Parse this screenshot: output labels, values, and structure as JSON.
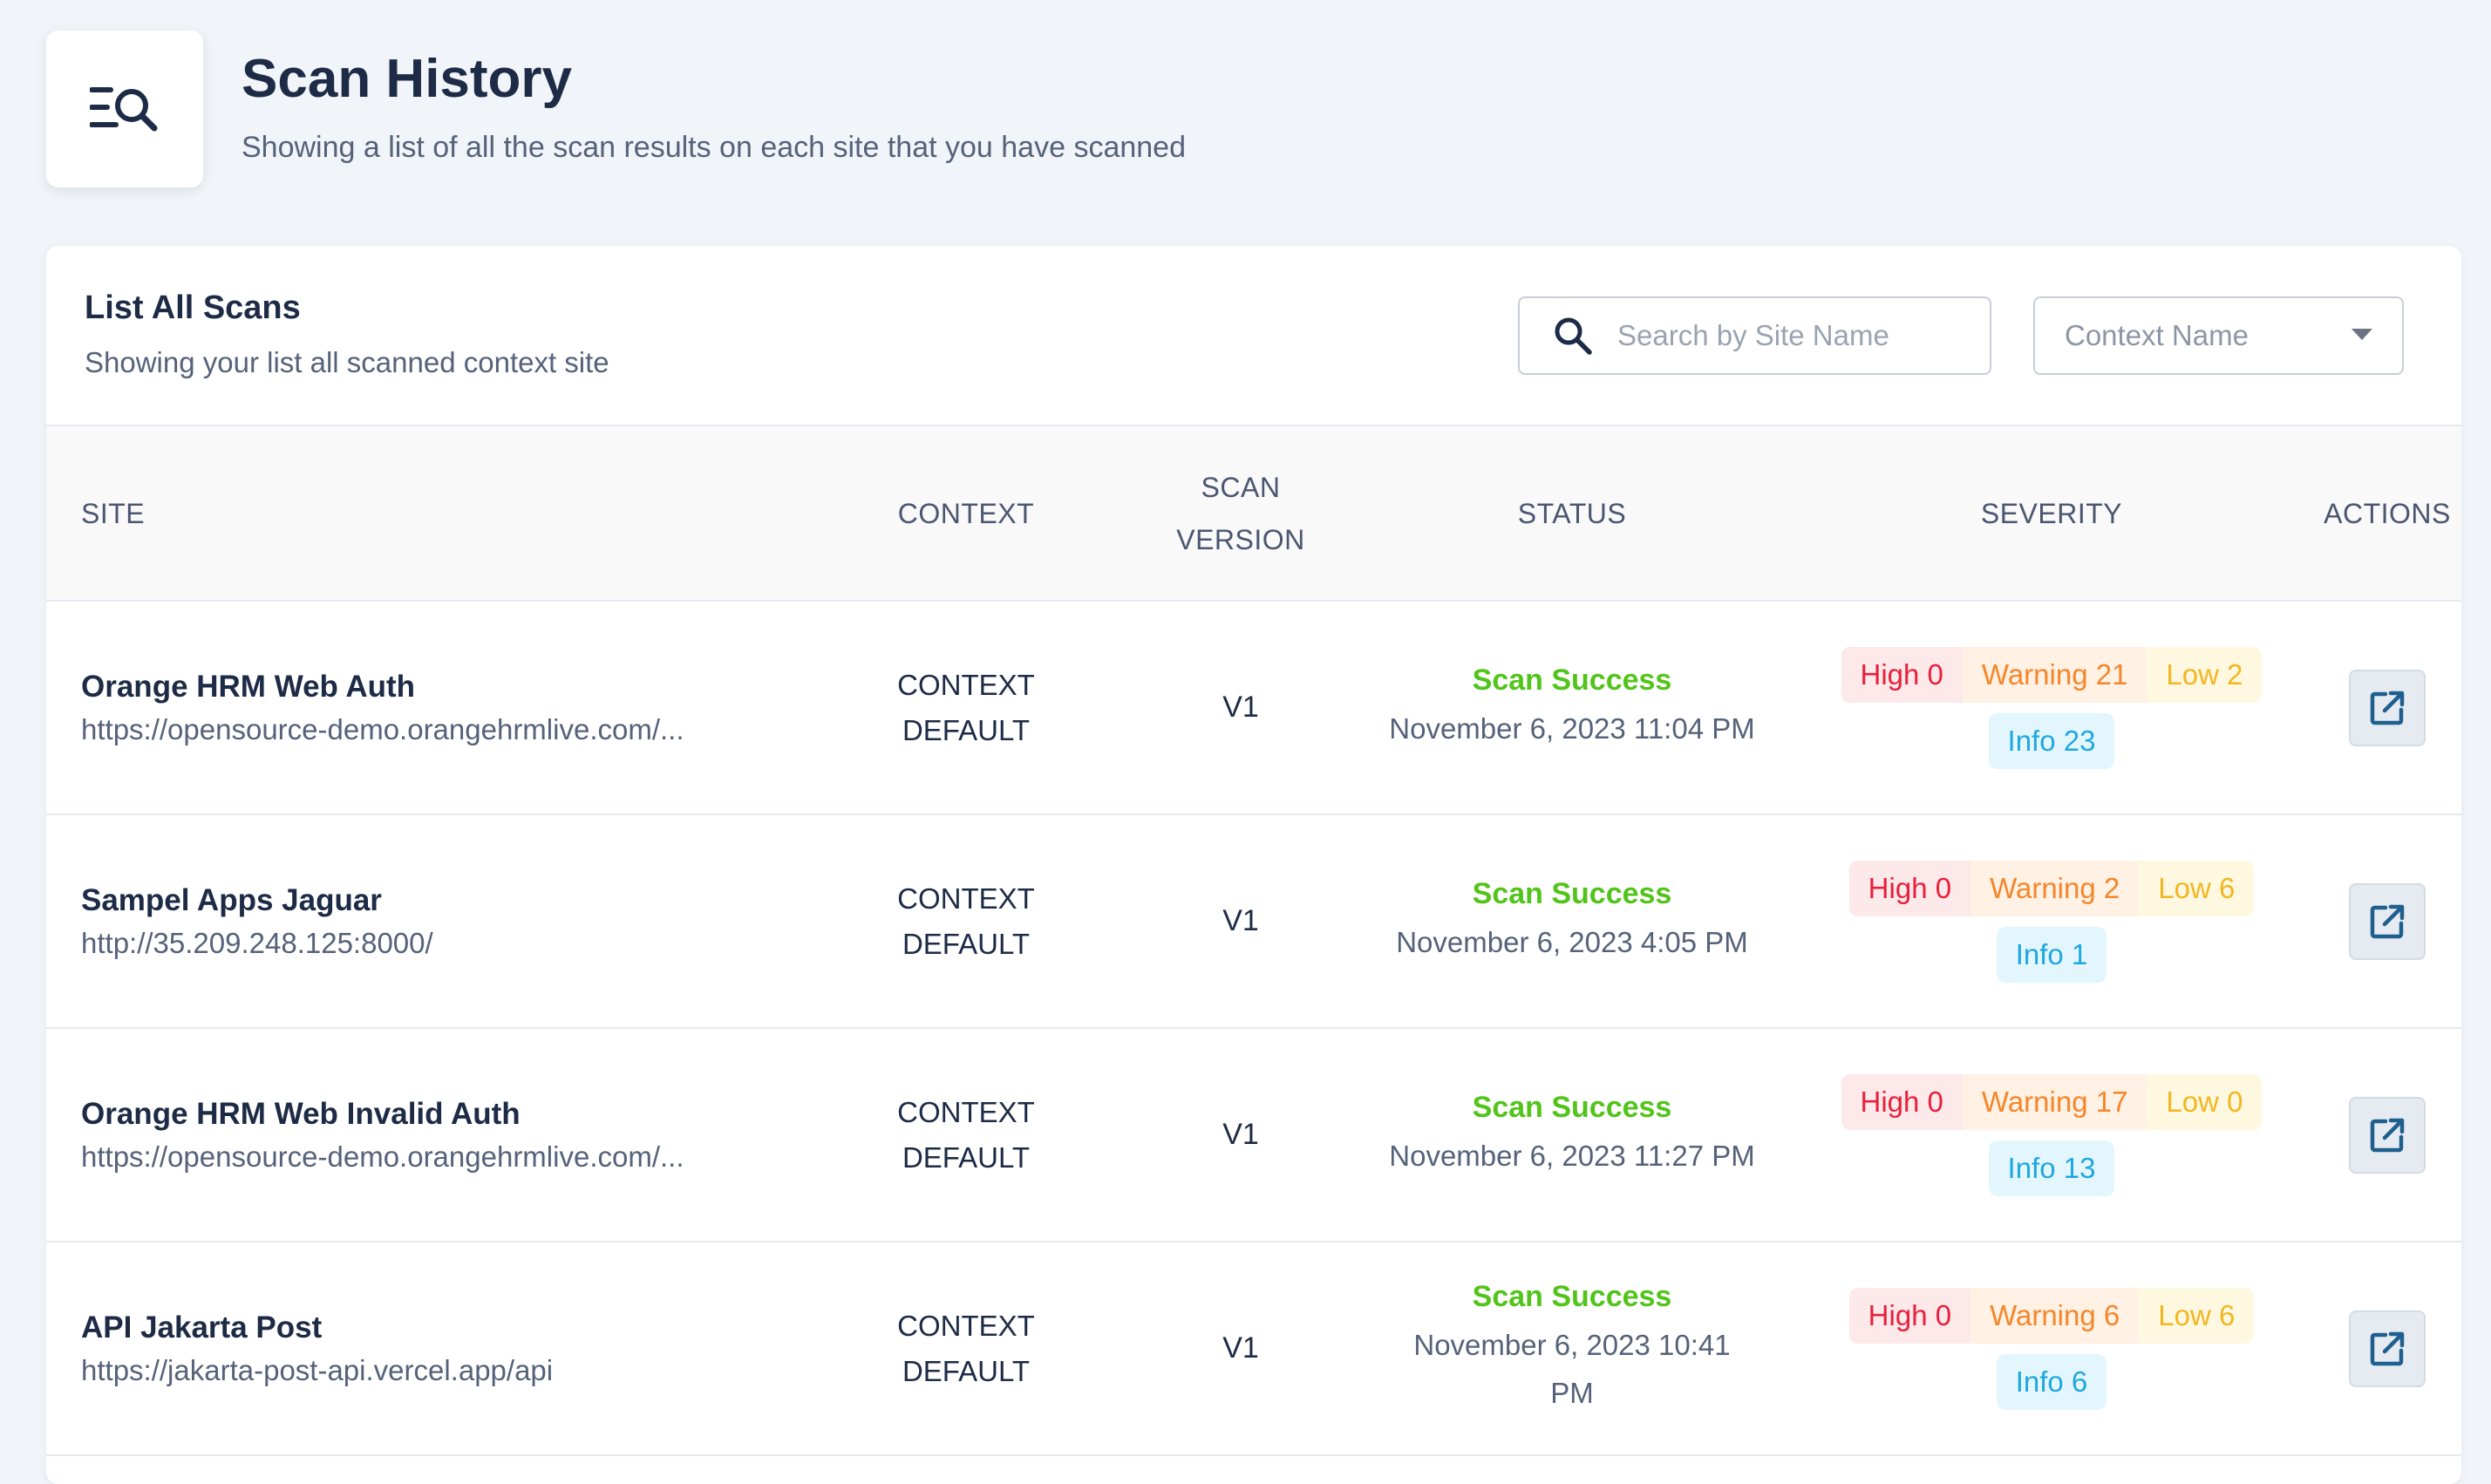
{
  "header": {
    "title": "Scan History",
    "subtitle": "Showing a list of all the scan results on each site that you have scanned",
    "icon": "scan-history-icon"
  },
  "card": {
    "title": "List All Scans",
    "subtitle": "Showing your list all scanned context site",
    "search": {
      "placeholder": "Search by Site Name",
      "value": ""
    },
    "context_filter": {
      "placeholder": "Context Name"
    }
  },
  "table": {
    "columns": {
      "site": "SITE",
      "context": "CONTEXT",
      "scan_version_line1": "SCAN",
      "scan_version_line2": "VERSION",
      "status": "STATUS",
      "severity": "SEVERITY",
      "actions": "ACTIONS"
    },
    "rows": [
      {
        "site_name": "Orange HRM Web Auth",
        "site_url": "https://opensource-demo.orangehrmlive.com/...",
        "context_line1": "CONTEXT",
        "context_line2": "DEFAULT",
        "version": "V1",
        "status": "Scan Success",
        "date": "November 6, 2023 11:04 PM",
        "high": "High 0",
        "warning": "Warning 21",
        "low": "Low 2",
        "info": "Info 23"
      },
      {
        "site_name": "Sampel Apps Jaguar",
        "site_url": "http://35.209.248.125:8000/",
        "context_line1": "CONTEXT",
        "context_line2": "DEFAULT",
        "version": "V1",
        "status": "Scan Success",
        "date": "November 6, 2023 4:05 PM",
        "high": "High 0",
        "warning": "Warning 2",
        "low": "Low 6",
        "info": "Info 1"
      },
      {
        "site_name": "Orange HRM Web Invalid Auth",
        "site_url": "https://opensource-demo.orangehrmlive.com/...",
        "context_line1": "CONTEXT",
        "context_line2": "DEFAULT",
        "version": "V1",
        "status": "Scan Success",
        "date": "November 6, 2023 11:27 PM",
        "high": "High 0",
        "warning": "Warning 17",
        "low": "Low 0",
        "info": "Info 13"
      },
      {
        "site_name": "API Jakarta Post",
        "site_url": "https://jakarta-post-api.vercel.app/api",
        "context_line1": "CONTEXT",
        "context_line2": "DEFAULT",
        "version": "V1",
        "status": "Scan Success",
        "date": "November 6, 2023 10:41 PM",
        "high": "High 0",
        "warning": "Warning 6",
        "low": "Low 6",
        "info": "Info 6"
      }
    ]
  },
  "icons": {
    "search": "search-icon",
    "dropdown": "chevron-down-icon",
    "action": "open-external-icon"
  },
  "colors": {
    "background": "#f1f4f8",
    "success": "#52c41a",
    "high": "#e8203b",
    "warning": "#f5862b",
    "low": "#f2b620",
    "info": "#1fa7e0"
  }
}
